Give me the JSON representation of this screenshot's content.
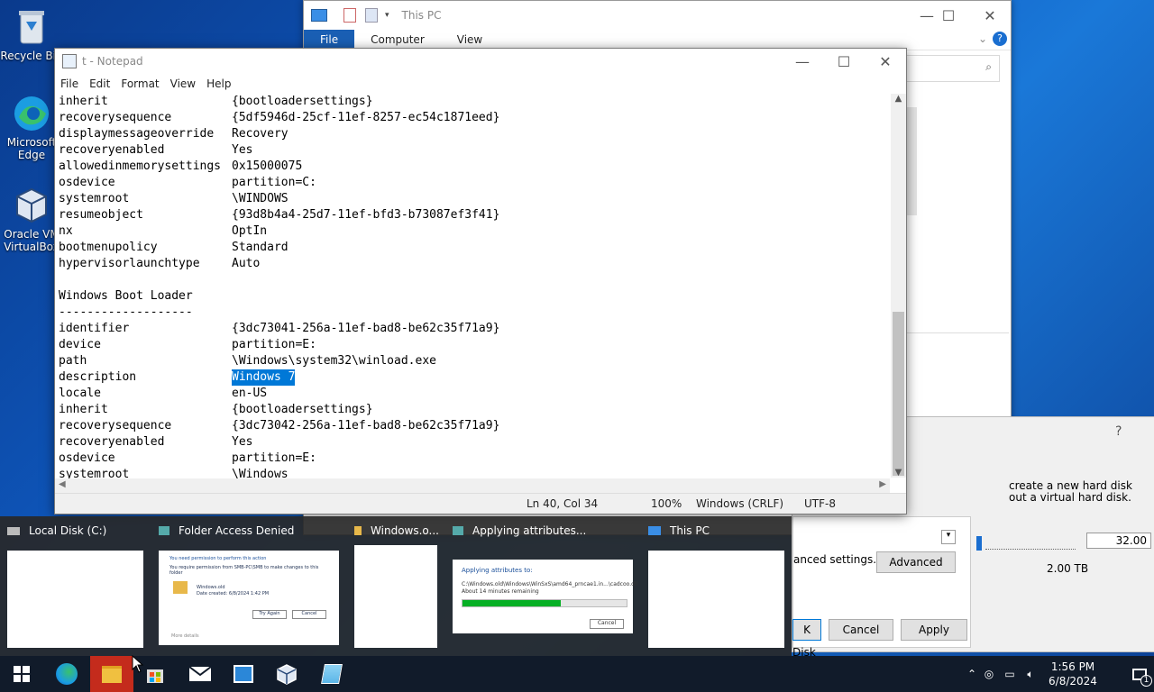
{
  "desktop": {
    "icons": [
      {
        "label": "Recycle Bin"
      },
      {
        "label": "Microsoft Edge"
      },
      {
        "label": "Oracle VM VirtualBox"
      }
    ]
  },
  "explorer": {
    "title": "This PC",
    "tabs": [
      "File",
      "Computer",
      "View"
    ]
  },
  "disk_dialog": {
    "help": "?",
    "text1": "create a new hard disk",
    "text2": "out a virtual hard disk.",
    "advanced_text": "anced settings.",
    "advanced_btn": "Advanced",
    "size_value": "32.00",
    "size_max": "2.00 TB",
    "cancel": "Cancel",
    "apply": "Apply",
    "disk_label": "Disk"
  },
  "notepad": {
    "title": "t - Notepad",
    "menu": [
      "File",
      "Edit",
      "Format",
      "View",
      "Help"
    ],
    "lines": [
      {
        "k": "inherit",
        "v": "{bootloadersettings}"
      },
      {
        "k": "recoverysequence",
        "v": "{5df5946d-25cf-11ef-8257-ec54c1871eed}"
      },
      {
        "k": "displaymessageoverride",
        "v": "Recovery"
      },
      {
        "k": "recoveryenabled",
        "v": "Yes"
      },
      {
        "k": "allowedinmemorysettings",
        "v": "0x15000075"
      },
      {
        "k": "osdevice",
        "v": "partition=C:"
      },
      {
        "k": "systemroot",
        "v": "\\WINDOWS"
      },
      {
        "k": "resumeobject",
        "v": "{93d8b4a4-25d7-11ef-bfd3-b73087ef3f41}"
      },
      {
        "k": "nx",
        "v": "OptIn"
      },
      {
        "k": "bootmenupolicy",
        "v": "Standard"
      },
      {
        "k": "hypervisorlaunchtype",
        "v": "Auto"
      },
      {
        "k": "",
        "v": ""
      },
      {
        "k": "Windows Boot Loader",
        "v": ""
      },
      {
        "k": "-------------------",
        "v": ""
      },
      {
        "k": "identifier",
        "v": "{3dc73041-256a-11ef-bad8-be62c35f71a9}"
      },
      {
        "k": "device",
        "v": "partition=E:"
      },
      {
        "k": "path",
        "v": "\\Windows\\system32\\winload.exe"
      },
      {
        "k": "description",
        "v": "Windows 7",
        "selected": true
      },
      {
        "k": "locale",
        "v": "en-US"
      },
      {
        "k": "inherit",
        "v": "{bootloadersettings}"
      },
      {
        "k": "recoverysequence",
        "v": "{3dc73042-256a-11ef-bad8-be62c35f71a9}"
      },
      {
        "k": "recoveryenabled",
        "v": "Yes"
      },
      {
        "k": "osdevice",
        "v": "partition=E:"
      },
      {
        "k": "systemroot",
        "v": "\\Windows"
      }
    ],
    "status": {
      "position": "Ln 40, Col 34",
      "zoom": "100%",
      "eol": "Windows (CRLF)",
      "encoding": "UTF-8"
    }
  },
  "switcher": {
    "items": [
      {
        "title": "Local Disk (C:)"
      },
      {
        "title": "Folder Access Denied",
        "msg1": "You need permission to perform this action",
        "msg2": "You require permission from SMB-PC\\SMB to make changes to this folder",
        "file": "Windows.old",
        "date": "Date created: 6/8/2024 1:42 PM",
        "try": "Try Again",
        "cancel": "Cancel",
        "more": "More details"
      },
      {
        "title": "Windows.o..."
      },
      {
        "title": "Applying attributes...",
        "heading": "Applying attributes to:",
        "path": "C:\\Windows.old\\Windows\\WinSxS\\amd64_prncae1.in...\\cadcoo.dll",
        "remain": "About 14 minutes remaining",
        "progress": 0.6,
        "cancel": "Cancel"
      },
      {
        "title": "This PC"
      }
    ]
  },
  "taskbar": {
    "time": "1:56 PM",
    "date": "6/8/2024",
    "notif_count": "1"
  }
}
